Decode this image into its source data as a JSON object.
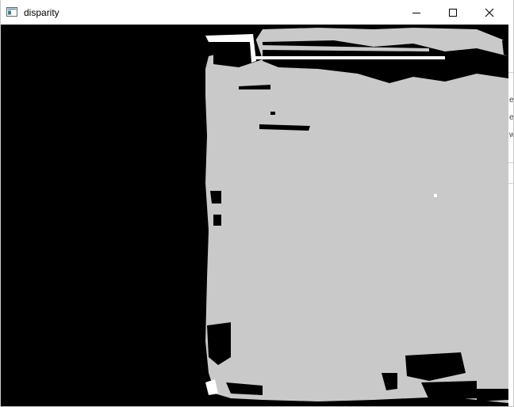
{
  "window": {
    "title": "disparity",
    "controls": {
      "minimize_icon": "minimize-icon",
      "maximize_icon": "maximize-icon",
      "close_icon": "close-icon"
    }
  },
  "image": {
    "description_type": "disparity-map",
    "background_color": "#000000",
    "foreground_color": "#c9c9c9",
    "highlight_color": "#ffffff"
  },
  "behind_window": {
    "text_fragments": [
      "el",
      "el",
      "w"
    ]
  }
}
